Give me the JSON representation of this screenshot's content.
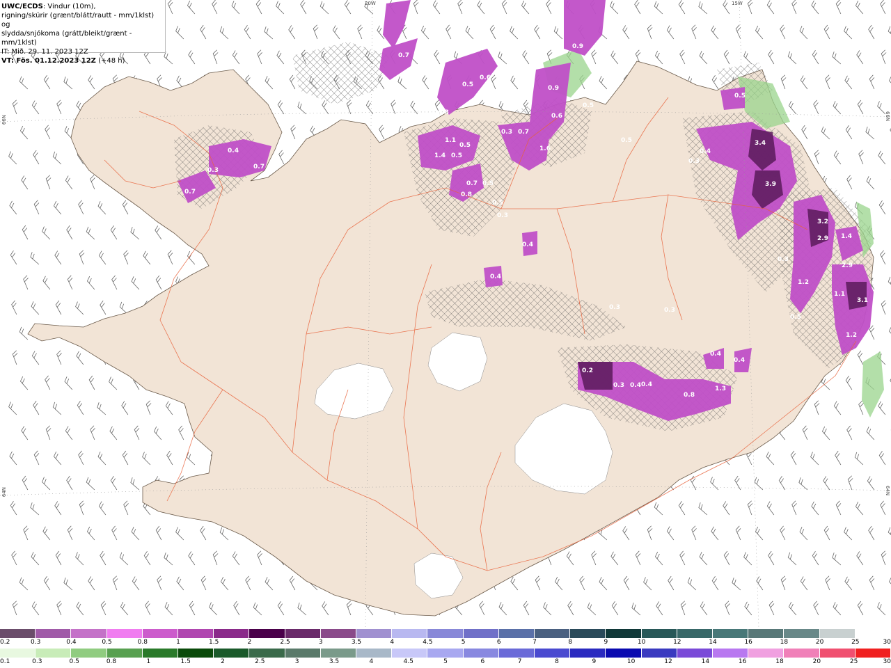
{
  "header": {
    "model_label": "UWC/ECDS",
    "line1_rest": ": Vindur (10m),",
    "line2": "rigning/skúrir (grænt/blátt/rautt - mm/1klst) og",
    "line3": "slydda/snjókoma (grátt/bleikt/grænt - mm/1klst)",
    "init_time": "IT: Mið. 29. 11. 2023 12Z",
    "valid_time_bold": "VT: Fös. 01.12.2023 12Z",
    "valid_time_rest": " (+48 h)"
  },
  "grid_labels": {
    "top_left": "20W",
    "top_right": "15W",
    "left_upper": "66N",
    "right_upper": "66N",
    "left_lower": "64N",
    "right_lower": "64N"
  },
  "map": {
    "land_color": "#f2e4d6",
    "sea_color": "#ffffff",
    "road_color": "#e8623a",
    "glacier_color": "#ffffff",
    "precip_labels": [
      {
        "label": "0.7"
      },
      {
        "label": "0.9"
      },
      {
        "label": "0.6"
      },
      {
        "label": "0.5"
      },
      {
        "label": "0.9"
      },
      {
        "label": "0.5"
      },
      {
        "label": "0.6"
      },
      {
        "label": "0.5"
      },
      {
        "label": "0.5"
      },
      {
        "label": "0.3"
      },
      {
        "label": "1.1"
      },
      {
        "label": "0.3"
      },
      {
        "label": "0.5"
      },
      {
        "label": "0.7"
      },
      {
        "label": "1.6"
      },
      {
        "label": "1.4"
      },
      {
        "label": "0.5"
      },
      {
        "label": "0.4"
      },
      {
        "label": "3.4"
      },
      {
        "label": "0.3"
      },
      {
        "label": "0.3"
      },
      {
        "label": "0.7"
      },
      {
        "label": "0.4"
      },
      {
        "label": "0.7"
      },
      {
        "label": "0.7"
      },
      {
        "label": "0.5"
      },
      {
        "label": "0.5"
      },
      {
        "label": "0.3"
      },
      {
        "label": "0.8"
      },
      {
        "label": "3.9"
      },
      {
        "label": "0.4"
      },
      {
        "label": "3.2"
      },
      {
        "label": "2.9"
      },
      {
        "label": "1.4"
      },
      {
        "label": "0.3"
      },
      {
        "label": "0.4"
      },
      {
        "label": "2.9"
      },
      {
        "label": "1.2"
      },
      {
        "label": "1.1"
      },
      {
        "label": "3.1"
      },
      {
        "label": "0.3"
      },
      {
        "label": "0.3"
      },
      {
        "label": "0.5"
      },
      {
        "label": "0.4"
      },
      {
        "label": "1.2"
      },
      {
        "label": "0.4"
      },
      {
        "label": "0.4"
      },
      {
        "label": "0.2"
      },
      {
        "label": "0.3"
      },
      {
        "label": "0.4"
      },
      {
        "label": "1.3"
      },
      {
        "label": "0.8"
      }
    ]
  },
  "legend_snow": {
    "colors": [
      "#6b4d6b",
      "#a05aa8",
      "#c472c8",
      "#f07cf0",
      "#cc5ccc",
      "#b046b0",
      "#8a2a8a",
      "#4a004a",
      "#6a2a6a",
      "#8a4a8a",
      "#a090d0",
      "#b8b8f0",
      "#8888d8",
      "#7070c8",
      "#5a70a8",
      "#4a6080",
      "#2a4a5a",
      "#103838",
      "#285858",
      "#386868",
      "#487878",
      "#587878",
      "#688888",
      "#c8d0d0",
      "#ffffff"
    ],
    "labels": [
      "0.2",
      "0.3",
      "0.4",
      "0.5",
      "0.8",
      "1",
      "1.5",
      "2",
      "2.5",
      "3",
      "3.5",
      "4",
      "4.5",
      "5",
      "6",
      "7",
      "8",
      "9",
      "10",
      "12",
      "14",
      "16",
      "18",
      "20",
      "25",
      "30"
    ]
  },
  "legend_rain": {
    "colors": [
      "#e8f8e0",
      "#c8ecb8",
      "#90cc80",
      "#58a050",
      "#2a7a2a",
      "#0a4a0a",
      "#1a5a2a",
      "#3a6a4a",
      "#5a7a6a",
      "#7a9a8a",
      "#a8b8c8",
      "#c8c8f8",
      "#a8a8f0",
      "#8888e0",
      "#6a6ad8",
      "#4a4ad0",
      "#2a2ac0",
      "#0a0ab0",
      "#3a3ac0",
      "#7a4ad8",
      "#b878f0",
      "#f0a0e0",
      "#f080b8",
      "#f05070",
      "#f02020"
    ],
    "labels": [
      "0.1",
      "0.3",
      "0.5",
      "0.8",
      "1",
      "1.5",
      "2",
      "2.5",
      "3",
      "3.5",
      "4",
      "4.5",
      "5",
      "6",
      "7",
      "8",
      "9",
      "10",
      "12",
      "14",
      "16",
      "18",
      "20",
      "25",
      "30"
    ]
  }
}
